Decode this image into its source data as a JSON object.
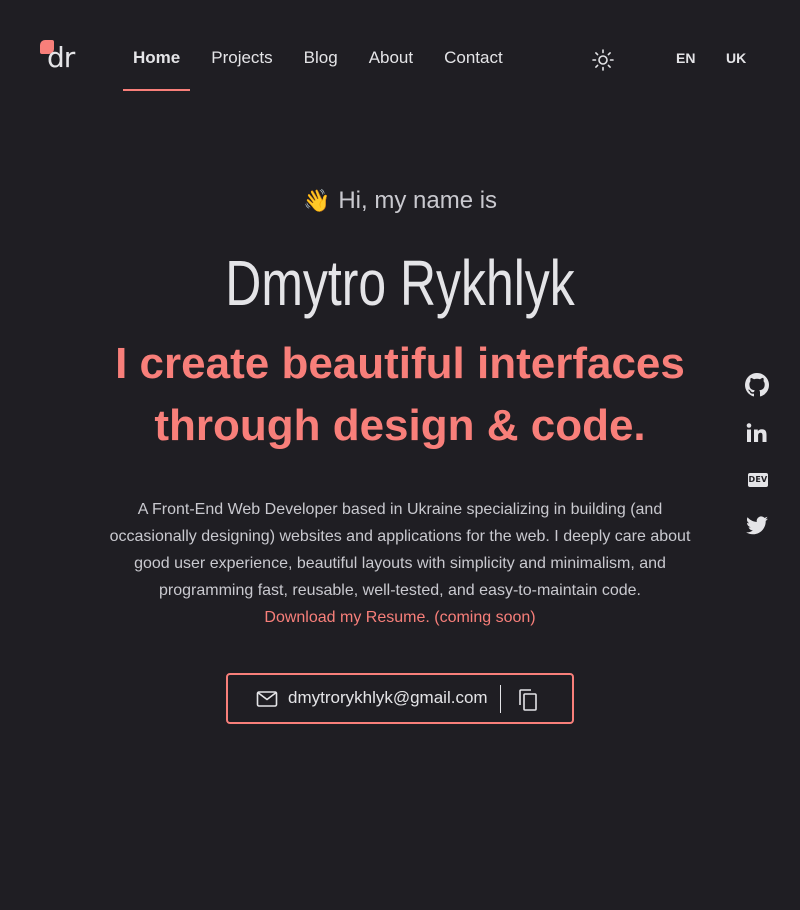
{
  "logo": {
    "text": "dr",
    "accent": "#f87f7a"
  },
  "nav": {
    "items": [
      {
        "label": "Home",
        "active": true
      },
      {
        "label": "Projects"
      },
      {
        "label": "Blog"
      },
      {
        "label": "About"
      },
      {
        "label": "Contact"
      }
    ]
  },
  "header": {
    "theme_icon": "sun-icon",
    "languages": [
      "EN",
      "UK"
    ]
  },
  "hero": {
    "wave_emoji": "👋",
    "greeting": "Hi, my name is",
    "name": "Dmytro Rykhlyk",
    "tagline_line1": "I create beautiful interfaces",
    "tagline_line2": "through design & code.",
    "description": "A Front-End Web Developer based in Ukraine specializing in building (and occasionally designing) websites and applications for the web. I deeply care about good user experience, beautiful layouts with simplicity and minimalism, and programming fast, reusable, well-tested, and easy-to-maintain code.",
    "resume_link": "Download my Resume. (coming soon)"
  },
  "contact": {
    "email": "dmytrorykhlyk@gmail.com",
    "mail_icon": "mail-icon",
    "copy_icon": "copy-icon"
  },
  "social": {
    "icons": [
      "github-icon",
      "linkedin-icon",
      "dev-icon",
      "twitter-icon"
    ],
    "dev_label": "DEV"
  },
  "colors": {
    "background": "#1f1e23",
    "accent": "#f87f7a",
    "text": "#e4e4e7"
  }
}
